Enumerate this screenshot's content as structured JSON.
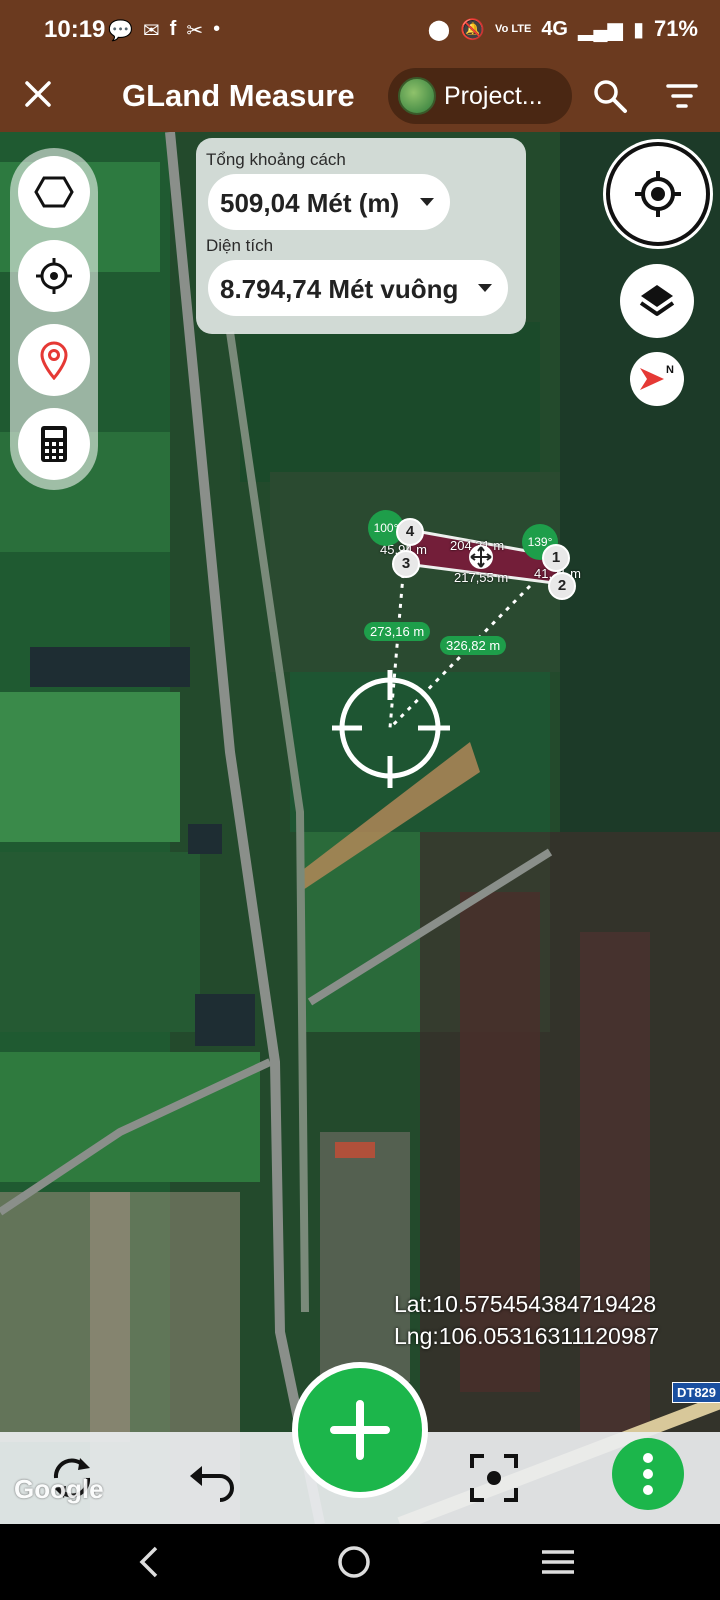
{
  "status": {
    "time": "10:19",
    "notification_icons": [
      "chat-bubble-icon",
      "message-badge-icon",
      "facebook-icon",
      "capcut-icon",
      "dot-icon"
    ],
    "network": "4G",
    "volte": "Vo LTE",
    "battery": "71%"
  },
  "appbar": {
    "title": "GLand Measure",
    "project_label": "Project...",
    "icons": [
      "close-icon",
      "search-icon",
      "filter-icon"
    ]
  },
  "measure": {
    "distance_label": "Tổng khoảng cách",
    "distance_value": "509,04 Mét (m)",
    "area_label": "Diện tích",
    "area_value": "8.794,74 Mét vuông"
  },
  "left_tools": [
    "polygon-icon",
    "crosshair-icon",
    "map-pin-icon",
    "calculator-icon"
  ],
  "right_tools": [
    "gps-locate-icon",
    "layers-icon",
    "compass-icon"
  ],
  "compass_letter": "N",
  "plot": {
    "vertices": [
      "1",
      "2",
      "3",
      "4"
    ],
    "edge_labels": [
      "204,31 m",
      "41,21 m",
      "217,55 m",
      "45,94 m"
    ],
    "angles": [
      "100°",
      "139°"
    ],
    "distances_to_target": [
      "273,16 m",
      "326,82 m"
    ],
    "colors": {
      "polygon_fill": "#7a1b3a",
      "badge": "#1e9e4a"
    }
  },
  "coordinates": {
    "lat": "Lat:10.575454384719428",
    "lng": "Lng:106.05316311120987"
  },
  "road_tag": "DT829",
  "map_attribution": "Google",
  "bottom_toolbar": {
    "icons": [
      "refresh-icon",
      "undo-icon",
      "add-icon",
      "focus-icon",
      "more-vertical-icon"
    ]
  },
  "navbar": {
    "icons": [
      "back-icon",
      "home-icon",
      "recents-icon"
    ]
  },
  "theme": {
    "appbar": "#6b3a1f",
    "accent": "#1cb64b"
  }
}
